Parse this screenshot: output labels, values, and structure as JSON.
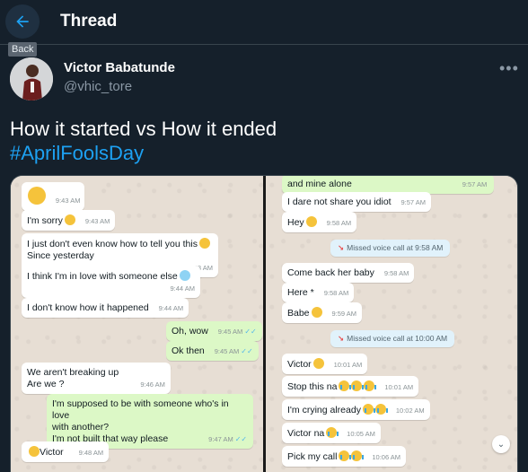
{
  "header": {
    "title": "Thread",
    "back_tooltip": "Back"
  },
  "author": {
    "name": "Victor Babatunde",
    "handle": "@vhic_tore"
  },
  "tweet": {
    "line1": "How it started vs How it ended",
    "hashtag": "#AprilFoolsDay"
  },
  "media": {
    "left": [
      {
        "text": "",
        "time": "9:43 AM",
        "emoji": "smirk"
      },
      {
        "text": "I'm sorry",
        "time": "9:43 AM",
        "emoji": "sad"
      },
      {
        "text": "I just don't even know how to tell you this",
        "text2": "Since yesterday",
        "time": "9:43 AM",
        "emoji": "worried"
      },
      {
        "text": "I think I'm in love with someone else",
        "time": "9:44 AM",
        "emoji": "cold"
      },
      {
        "text": "I don't know how it happened",
        "time": "9:44 AM"
      },
      {
        "text": "Oh, wow",
        "time": "9:45 AM"
      },
      {
        "text": "Ok then",
        "time": "9:45 AM"
      },
      {
        "text": "We aren't breaking up",
        "text2": "Are we ?",
        "time": "9:46 AM"
      },
      {
        "text": "I'm supposed to be with someone who's in love",
        "text2": "with another?",
        "text3": "I'm not built that way please",
        "time": "9:47 AM"
      },
      {
        "text": "Victor",
        "time": "9:48 AM",
        "emoji": "shock"
      }
    ],
    "right": [
      {
        "text": "and mine alone",
        "time": "9:57 AM"
      },
      {
        "text": "I dare not share you idiot",
        "time": "9:57 AM"
      },
      {
        "text": "Hey",
        "time": "9:58 AM",
        "emoji": "grin"
      },
      {
        "text": "Missed voice call at 9:58 AM"
      },
      {
        "text": "Come back her baby",
        "time": "9:58 AM"
      },
      {
        "text": "Here *",
        "time": "9:58 AM"
      },
      {
        "text": "Babe",
        "time": "9:59 AM",
        "emoji": "shock"
      },
      {
        "text": "Missed voice call at 10:00 AM"
      },
      {
        "text": "Victor",
        "time": "10:01 AM",
        "emoji": "shock"
      },
      {
        "text": "Stop this na",
        "time": "10:01 AM",
        "emoji": "cry"
      },
      {
        "text": "I'm crying already",
        "time": "10:02 AM",
        "emoji": "cry"
      },
      {
        "text": "Victor na",
        "time": "10:05 AM",
        "emoji": "cry"
      },
      {
        "text": "Pick my call",
        "time": "10:06 AM",
        "emoji": "cry"
      }
    ]
  }
}
